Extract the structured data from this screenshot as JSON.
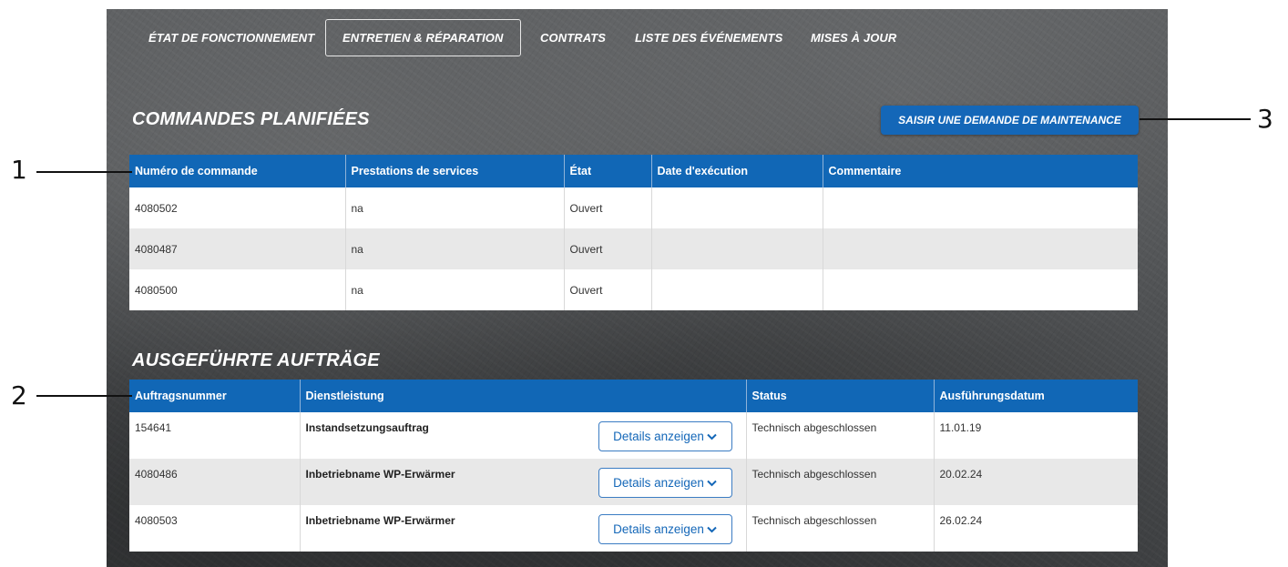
{
  "nav": {
    "tabs": [
      {
        "label": "ÉTAT DE FONCTIONNEMENT",
        "active": false
      },
      {
        "label": "ENTRETIEN & RÉPARATION",
        "active": true
      },
      {
        "label": "CONTRATS",
        "active": false
      },
      {
        "label": "LISTE DES ÉVÉNEMENTS",
        "active": false
      },
      {
        "label": "MISES À JOUR",
        "active": false
      }
    ]
  },
  "planned": {
    "title": "COMMANDES PLANIFIÉES",
    "button_label": "SAISIR UNE DEMANDE DE MAINTENANCE",
    "columns": [
      "Numéro de commande",
      "Prestations de services",
      "État",
      "Date d'exécution",
      "Commentaire"
    ],
    "rows": [
      {
        "number": "4080502",
        "service": "na",
        "state": "Ouvert",
        "date": "",
        "comment": ""
      },
      {
        "number": "4080487",
        "service": "na",
        "state": "Ouvert",
        "date": "",
        "comment": ""
      },
      {
        "number": "4080500",
        "service": "na",
        "state": "Ouvert",
        "date": "",
        "comment": ""
      }
    ]
  },
  "executed": {
    "title": "AUSGEFÜHRTE AUFTRÄGE",
    "columns": [
      "Auftragsnummer",
      "Dienstleistung",
      "Status",
      "Ausführungsdatum"
    ],
    "details_label": "Details anzeigen",
    "rows": [
      {
        "number": "154641",
        "service": "Instandsetzungsauftrag",
        "status": "Technisch abgeschlossen",
        "date": "11.01.19"
      },
      {
        "number": "4080486",
        "service": "Inbetriebname WP-Erwärmer",
        "status": "Technisch abgeschlossen",
        "date": "20.02.24"
      },
      {
        "number": "4080503",
        "service": "Inbetriebname WP-Erwärmer",
        "status": "Technisch abgeschlossen",
        "date": "26.02.24"
      }
    ]
  },
  "callouts": [
    "1",
    "2",
    "3"
  ],
  "colors": {
    "header_blue": "#1167b6",
    "button_blue": "#1467b8",
    "stripe": "#e8e8e8"
  }
}
